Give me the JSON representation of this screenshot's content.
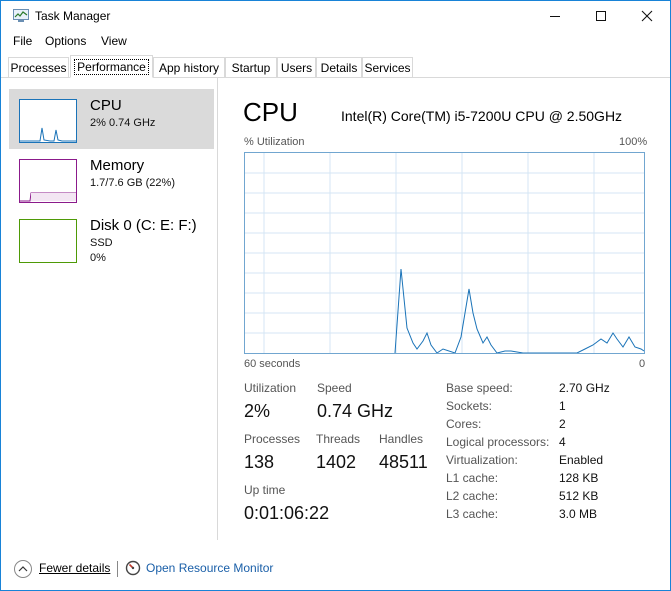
{
  "window": {
    "title": "Task Manager"
  },
  "menu": [
    "File",
    "Options",
    "View"
  ],
  "tabs": [
    "Processes",
    "Performance",
    "App history",
    "Startup",
    "Users",
    "Details",
    "Services"
  ],
  "active_tab": "Performance",
  "left_pane": {
    "cpu": {
      "name": "CPU",
      "sub": "2% 0.74 GHz"
    },
    "memory": {
      "name": "Memory",
      "sub": "1.7/7.6 GB (22%)"
    },
    "disk": {
      "name": "Disk 0 (C: E: F:)",
      "sub1": "SSD",
      "sub2": "0%"
    }
  },
  "main": {
    "title": "CPU",
    "model": "Intel(R) Core(TM) i5-7200U CPU @ 2.50GHz",
    "graph_label": "% Utilization",
    "graph_max": "100%",
    "graph_time": "60 seconds",
    "graph_min": "0",
    "stats": {
      "utilization_label": "Utilization",
      "utilization_value": "2%",
      "speed_label": "Speed",
      "speed_value": "0.74 GHz",
      "processes_label": "Processes",
      "processes_value": "138",
      "threads_label": "Threads",
      "threads_value": "1402",
      "handles_label": "Handles",
      "handles_value": "48511",
      "uptime_label": "Up time",
      "uptime_value": "0:01:06:22"
    },
    "specs": [
      {
        "label": "Base speed:",
        "value": "2.70 GHz"
      },
      {
        "label": "Sockets:",
        "value": "1"
      },
      {
        "label": "Cores:",
        "value": "2"
      },
      {
        "label": "Logical processors:",
        "value": "4"
      },
      {
        "label": "Virtualization:",
        "value": "Enabled"
      },
      {
        "label": "L1 cache:",
        "value": "128 KB"
      },
      {
        "label": "L2 cache:",
        "value": "512 KB"
      },
      {
        "label": "L3 cache:",
        "value": "3.0 MB"
      }
    ]
  },
  "footer": {
    "fewer_details": "Fewer details",
    "open_resource_monitor": "Open Resource Monitor"
  },
  "colors": {
    "accent": "#1883d7",
    "cpu_graph": "#1a73b8",
    "memory_graph": "#8b1a8b",
    "disk_graph": "#4e9a06",
    "selected_bg": "#dadada"
  }
}
